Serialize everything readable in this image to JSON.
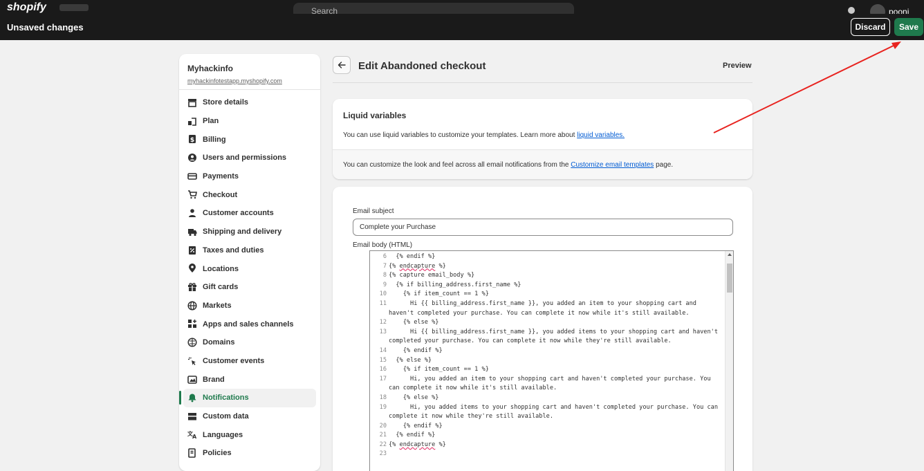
{
  "topbar": {
    "logo": "shopify",
    "search_placeholder": "Search",
    "user": "pooni ousie"
  },
  "savebar": {
    "title": "Unsaved changes",
    "discard_label": "Discard",
    "save_label": "Save"
  },
  "sidebar": {
    "store_name": "Myhackinfo",
    "store_domain": "myhackinfotestapp.myshopify.com",
    "items": [
      {
        "label": "Store details",
        "icon": "store-icon"
      },
      {
        "label": "Plan",
        "icon": "plan-icon"
      },
      {
        "label": "Billing",
        "icon": "billing-icon"
      },
      {
        "label": "Users and permissions",
        "icon": "user-icon"
      },
      {
        "label": "Payments",
        "icon": "payments-icon"
      },
      {
        "label": "Checkout",
        "icon": "cart-icon"
      },
      {
        "label": "Customer accounts",
        "icon": "person-icon"
      },
      {
        "label": "Shipping and delivery",
        "icon": "truck-icon"
      },
      {
        "label": "Taxes and duties",
        "icon": "tax-icon"
      },
      {
        "label": "Locations",
        "icon": "location-icon"
      },
      {
        "label": "Gift cards",
        "icon": "gift-icon"
      },
      {
        "label": "Markets",
        "icon": "globe-icon"
      },
      {
        "label": "Apps and sales channels",
        "icon": "apps-icon"
      },
      {
        "label": "Domains",
        "icon": "domain-icon"
      },
      {
        "label": "Customer events",
        "icon": "cursor-icon"
      },
      {
        "label": "Brand",
        "icon": "brand-icon"
      },
      {
        "label": "Notifications",
        "icon": "bell-icon"
      },
      {
        "label": "Custom data",
        "icon": "data-icon"
      },
      {
        "label": "Languages",
        "icon": "language-icon"
      },
      {
        "label": "Policies",
        "icon": "policy-icon"
      }
    ]
  },
  "header": {
    "title": "Edit Abandoned checkout",
    "preview_label": "Preview"
  },
  "liquid_card": {
    "heading": "Liquid variables",
    "text": "You can use liquid variables to customize your templates. Learn more about ",
    "link": "liquid variables.",
    "footer_text": "You can customize the look and feel across all email notifications from the ",
    "footer_link": "Customize email templates",
    "footer_suffix": " page."
  },
  "email_form": {
    "subject_label": "Email subject",
    "subject_value": "Complete your Purchase",
    "body_label": "Email body (HTML)",
    "code_lines": [
      {
        "n": "6",
        "t": "  {% endif %}"
      },
      {
        "n": "7",
        "t": "{% endcapture %}",
        "sq": "endcapture"
      },
      {
        "n": "8",
        "t": "{% capture email_body %}"
      },
      {
        "n": "9",
        "t": "  {% if billing_address.first_name %}"
      },
      {
        "n": "10",
        "t": "    {% if item_count == 1 %}"
      },
      {
        "n": "11",
        "t": "      Hi {{ billing_address.first_name }}, you added an item to your shopping cart and haven't completed your purchase. You can complete it now while it's still available."
      },
      {
        "n": "12",
        "t": "    {% else %}"
      },
      {
        "n": "13",
        "t": "      Hi {{ billing_address.first_name }}, you added items to your shopping cart and haven't completed your purchase. You can complete it now while they're still available."
      },
      {
        "n": "14",
        "t": "    {% endif %}"
      },
      {
        "n": "15",
        "t": "  {% else %}"
      },
      {
        "n": "16",
        "t": "    {% if item_count == 1 %}"
      },
      {
        "n": "17",
        "t": "      Hi, you added an item to your shopping cart and haven't completed your purchase. You can complete it now while it's still available."
      },
      {
        "n": "18",
        "t": "    {% else %}"
      },
      {
        "n": "19",
        "t": "      Hi, you added items to your shopping cart and haven't completed your purchase. You can complete it now while they're still available."
      },
      {
        "n": "20",
        "t": "    {% endif %}"
      },
      {
        "n": "21",
        "t": "  {% endif %}"
      },
      {
        "n": "22",
        "t": "{% endcapture %}",
        "sq": "endcapture"
      },
      {
        "n": "23",
        "t": ""
      }
    ]
  },
  "colors": {
    "accent": "#1f7a4d",
    "dark_bar": "#1a1a1a",
    "link": "#005bd3",
    "annotation_arrow": "#e8231f"
  }
}
